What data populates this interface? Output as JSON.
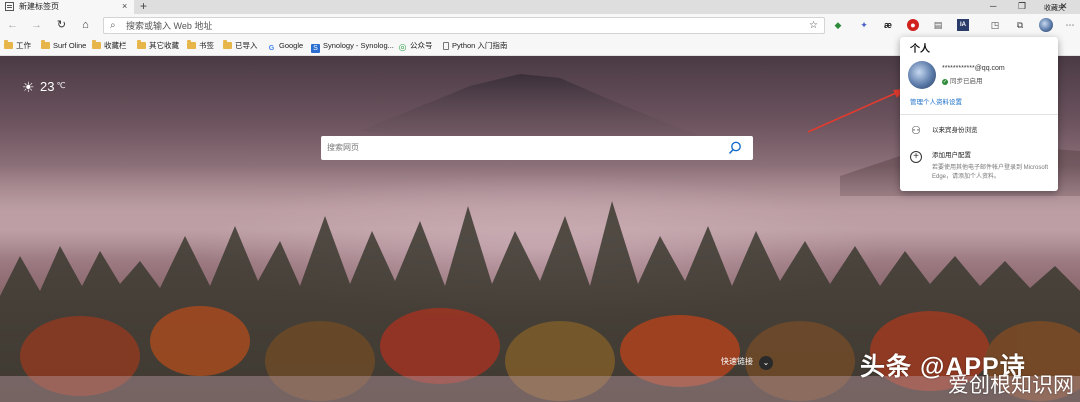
{
  "tab": {
    "title": "新建标签页",
    "close": "×",
    "new": "+"
  },
  "window_controls": {
    "min": "─",
    "max": "❐",
    "close": "✕"
  },
  "nav": {
    "back": "←",
    "forward": "→",
    "refresh": "↻",
    "home": "⌂"
  },
  "address": {
    "placeholder": "搜索或输入 Web 地址"
  },
  "extensions": [
    "green-leaf-icon",
    "butterfly-icon",
    "ae-icon",
    "red-circle-icon",
    "reader-icon",
    "ia-icon",
    "window-icon"
  ],
  "extension_labels": {
    "ae": "æ",
    "ia": "IA"
  },
  "bookmarks": [
    {
      "label": "工作",
      "type": "folder"
    },
    {
      "label": "Surf Oline",
      "type": "folder"
    },
    {
      "label": "收藏栏",
      "type": "folder"
    },
    {
      "label": "其它收藏",
      "type": "folder"
    },
    {
      "label": "书签",
      "type": "folder"
    },
    {
      "label": "已导入",
      "type": "folder"
    },
    {
      "label": "Google",
      "type": "google"
    },
    {
      "label": "Synology - Synolog...",
      "type": "synology"
    },
    {
      "label": "公众号",
      "type": "wechat"
    },
    {
      "label": "Python 入门指南",
      "type": "doc"
    }
  ],
  "bookmarks_right": "收藏夹",
  "weather": {
    "temp": "23",
    "unit": "℃"
  },
  "search": {
    "placeholder": "搜索网页"
  },
  "quick_links": "快速链接",
  "watermark": {
    "line1": "头条 @APP诗",
    "line2": "爱创根知识网"
  },
  "profile": {
    "title": "个人",
    "email": "************@qq.com",
    "sync_status": "同步已启用",
    "manage": "管理个人资料设置",
    "guest": "以来宾身份浏览",
    "add": "添加用户配置",
    "add_desc": "若要使用其他电子邮件帐户登录到 Microsoft Edge，请添加个人资料。"
  },
  "colors": {
    "accent": "#1a6ec8",
    "sync": "#2e8b3a",
    "arrow": "#e23b2e"
  }
}
